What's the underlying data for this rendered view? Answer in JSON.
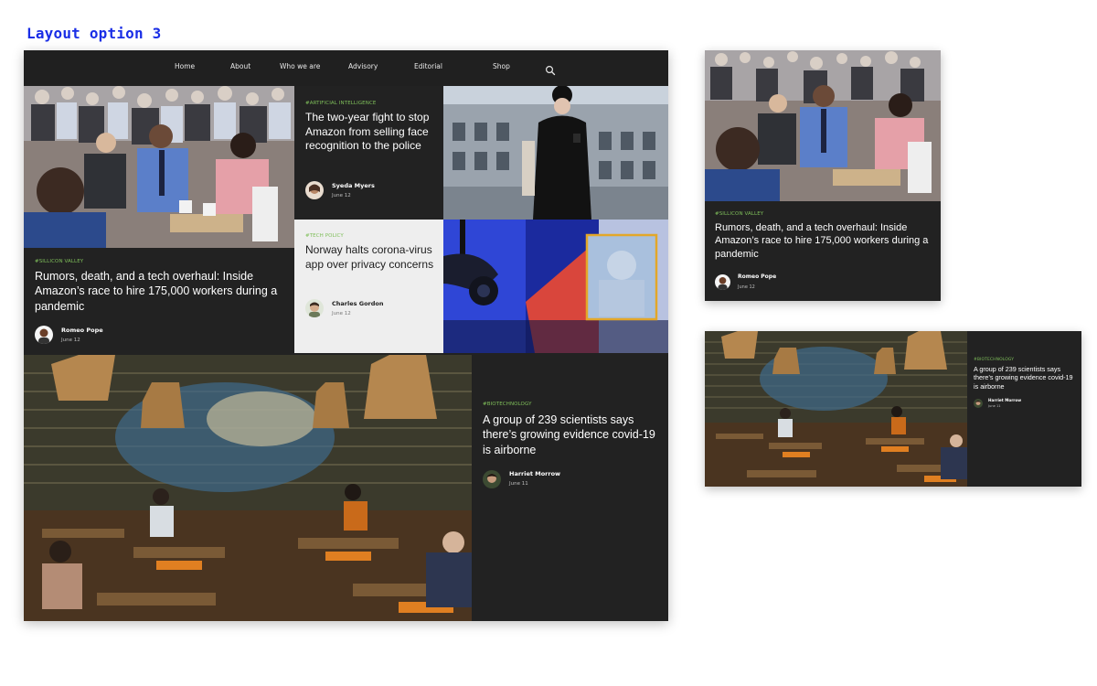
{
  "option_title": "Layout option 3",
  "nav": {
    "items": [
      "Home",
      "About",
      "Who we are",
      "Advisory",
      "Editorial",
      "Shop"
    ],
    "search_icon": "search-icon"
  },
  "articles": {
    "silicon": {
      "tag": "#SILLICON VALLEY",
      "headline": "Rumors, death, and a tech overhaul: Inside Amazon’s race to hire 175,000 workers during a pandemic",
      "author": "Romeo Pope",
      "date": "June 12"
    },
    "ai": {
      "tag": "#ARTIFICIAL INTELLIGENCE",
      "headline": "The two-year fight to stop Amazon from selling face recognition to the police",
      "author": "Syeda Myers",
      "date": "June 12"
    },
    "techpolicy": {
      "tag": "#TECH POLICY",
      "headline": "Norway halts corona-virus app over privacy concerns",
      "author": "Charles Gordon",
      "date": "June 12"
    },
    "biotech": {
      "tag": "#BIOTECHNOLOGY",
      "headline": "A group of 239 scientists says there’s growing evidence covid-19 is airborne",
      "author": "Harriet Morrow",
      "date": "June 11"
    }
  },
  "colors": {
    "background": "#222222",
    "tag": "#7fbf5a",
    "title": "#1a2ee6",
    "light_panel": "#eeeeee"
  }
}
